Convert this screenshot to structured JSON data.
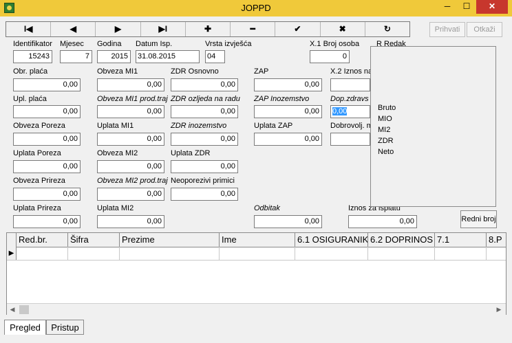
{
  "window": {
    "title": "JOPPD",
    "min_label": "─",
    "max_label": "☐",
    "close_label": "✕"
  },
  "nav": {
    "first": "I◀",
    "prev": "◀",
    "next": "▶",
    "last": "▶I",
    "add": "✚",
    "delete": "━",
    "post": "✔",
    "cancel": "✖",
    "refresh": "↻"
  },
  "actions": {
    "accept": "Prihvati",
    "cancel": "Otkaži",
    "redni_broj": "Redni broj"
  },
  "header": {
    "identifikator": {
      "label": "Identifikator",
      "value": "15243"
    },
    "mjesec": {
      "label": "Mjesec",
      "value": "7"
    },
    "godina": {
      "label": "Godina",
      "value": "2015"
    },
    "datum": {
      "label": "Datum Isp.",
      "value": "31.08.2015"
    },
    "vrsta": {
      "label": "Vrsta izvješća",
      "value": "04"
    },
    "broj_osoba": {
      "label": "X.1 Broj osoba",
      "value": "0"
    },
    "broj_peek": "R  Redak"
  },
  "fields": {
    "obr_placa": {
      "label": "Obr. plaća",
      "value": "0,00"
    },
    "upl_placa": {
      "label": "Upl. plaća",
      "value": "0,00"
    },
    "obveza_poreza": {
      "label": "Obveza Poreza",
      "value": "0,00"
    },
    "uplata_poreza": {
      "label": "Uplata Poreza",
      "value": "0,00"
    },
    "obveza_prireza": {
      "label": "Obveza Prireza",
      "value": "0,00"
    },
    "uplata_prireza": {
      "label": "Uplata Prireza",
      "value": "0,00"
    },
    "obveza_mi1": {
      "label": "Obveza MI1",
      "value": "0,00"
    },
    "obveza_mi1_prod": {
      "label": "Obveza MI1 prod.traj",
      "value": "0,00"
    },
    "uplata_mi1": {
      "label": "Uplata MI1",
      "value": "0,00"
    },
    "obveza_mi2": {
      "label": "Obveza MI2",
      "value": "0,00"
    },
    "obveza_mi2_prod": {
      "label": "Obveza MI2 prod.traj",
      "value": "0,00"
    },
    "uplata_mi2": {
      "label": "Uplata MI2",
      "value": "0,00"
    },
    "zdr_osnovno": {
      "label": "ZDR Osnovno",
      "value": "0,00"
    },
    "zdr_ozljeda": {
      "label": "ZDR ozljeda na radu",
      "value": "0,00"
    },
    "zdr_inozemstvo": {
      "label": "ZDR inozemstvo",
      "value": "0,00"
    },
    "uplata_zdr": {
      "label": "Uplata ZDR",
      "value": "0,00"
    },
    "neoporezivi": {
      "label": "Neoporezivi primici",
      "value": "0,00"
    },
    "zap": {
      "label": "ZAP",
      "value": "0,00"
    },
    "zap_inozemstvo": {
      "label": "ZAP Inozemstvo",
      "value": "0,00"
    },
    "uplata_zap": {
      "label": "Uplata ZAP",
      "value": "0,00"
    },
    "odbitak": {
      "label": "Odbitak",
      "value": "0,00"
    },
    "x2_iznos": {
      "label": "X.2 Iznos na",
      "value": ""
    },
    "dop_zdravstvo": {
      "label": "Dop.zdravs",
      "value": "0,00"
    },
    "dobrovoljno": {
      "label": "Dobrovolj. m",
      "value": ""
    },
    "iznos_isplatu": {
      "label": "Iznos za isplatu",
      "value": "0,00"
    }
  },
  "popup_items": [
    "Bruto",
    "MIO",
    "MI2",
    "ZDR",
    "Neto"
  ],
  "grid": {
    "columns": [
      "Red.br.",
      "Šifra",
      "Prezime",
      "Ime",
      "6.1 OSIGURANIK",
      "6.2 DOPRINOS",
      "7.1",
      "8.P"
    ],
    "row_indicator": "▶"
  },
  "scroll": {
    "left": "◀",
    "right": "▶"
  },
  "tabs": {
    "pregled": "Pregled",
    "pristup": "Pristup"
  }
}
